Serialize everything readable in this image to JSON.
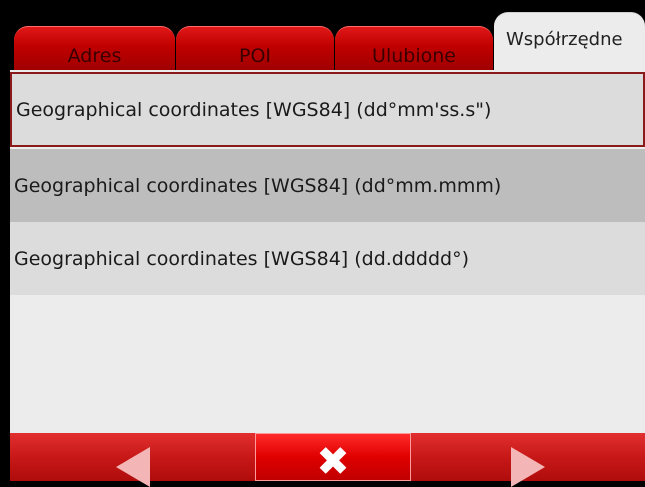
{
  "tabs": [
    {
      "label": "Adres",
      "active": false
    },
    {
      "label": "POI",
      "active": false
    },
    {
      "label": "Ulubione",
      "active": false
    },
    {
      "label": "Współrzędne",
      "active": true
    }
  ],
  "list": {
    "items": [
      {
        "label": "Geographical coordinates [WGS84] (dd°mm'ss.s\")",
        "state": "focused"
      },
      {
        "label": "Geographical coordinates [WGS84] (dd°mm.mmm)",
        "state": "selected"
      },
      {
        "label": "Geographical coordinates [WGS84] (dd.ddddd°)",
        "state": "normal"
      }
    ]
  },
  "toolbar": {
    "left_icon": "arrow-left-icon",
    "center_icon": "close-icon",
    "center_glyph": "✖",
    "right_icon": "arrow-right-icon"
  },
  "colors": {
    "accent": "#c00000",
    "tab_active": "#ececec",
    "row_selected": "#bdbdbd",
    "row_normal": "#dcdcdc",
    "focus_border": "#8b1a1a"
  }
}
